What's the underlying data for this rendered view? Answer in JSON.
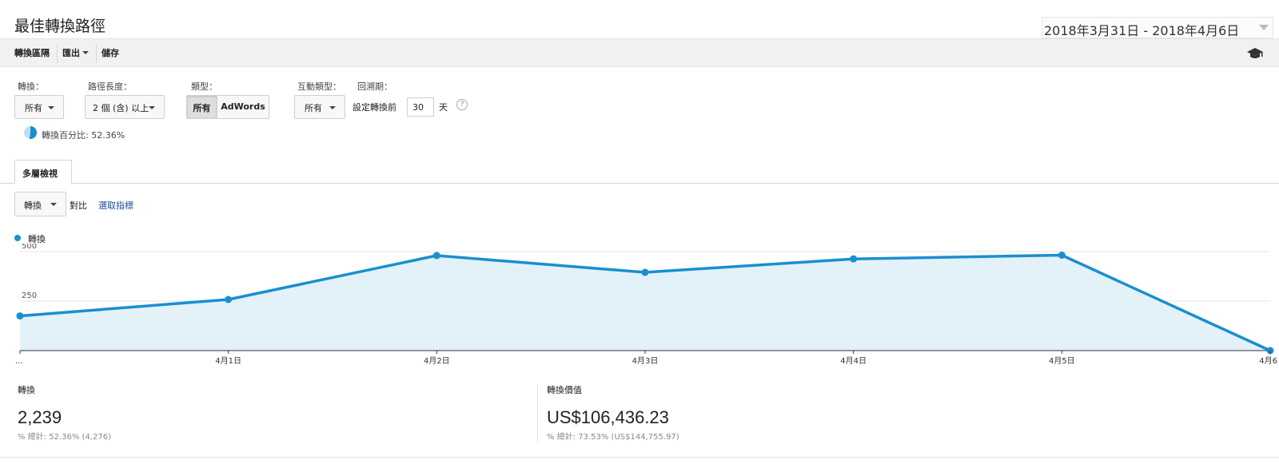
{
  "header": {
    "title": "最佳轉換路徑",
    "date_range": "2018年3月31日 - 2018年4月6日"
  },
  "toolbar": {
    "conversion_segments": "轉換區隔",
    "export": "匯出",
    "save": "儲存"
  },
  "filters": {
    "conversion_label": "轉換：",
    "conversion_value": "所有",
    "path_length_label": "路徑長度：",
    "path_length_value": "2 個 (含) 以上",
    "type_label": "類型：",
    "type_options": [
      "所有",
      "AdWords"
    ],
    "interaction_type_label": "互動類型：",
    "interaction_type_value": "所有",
    "lookback_label": "回溯期：",
    "lookback_prefix": "設定轉換前",
    "lookback_value": "30",
    "lookback_suffix": "天",
    "help": "?",
    "conversion_percent": "轉換百分比: 52.36%",
    "conversion_percent_value": 52.36
  },
  "tabs": [
    {
      "label": "多層檢視"
    }
  ],
  "metric": {
    "selected": "轉換",
    "vs": "對比",
    "select_metric": "選取指標"
  },
  "colors": {
    "line": "#1a8fcf",
    "area": "#e3f1f9"
  },
  "chart_data": {
    "type": "area",
    "legend": [
      "轉換"
    ],
    "x_labels": [
      "...",
      "4月1日",
      "4月2日",
      "4月3日",
      "4月4日",
      "4月5日",
      "4月6"
    ],
    "series": [
      {
        "name": "轉換",
        "values": [
          175,
          258,
          480,
          395,
          463,
          482,
          0
        ]
      }
    ],
    "yticks": [
      500,
      250
    ],
    "ylim": [
      0,
      500
    ],
    "grid": true
  },
  "summary": [
    {
      "label": "轉換",
      "value": "2,239",
      "sub": "% 總計: 52.36% (4,276)"
    },
    {
      "label": "轉換價值",
      "value": "US$106,436.23",
      "sub": "% 總計: 73.53% (US$144,755.97)"
    }
  ]
}
